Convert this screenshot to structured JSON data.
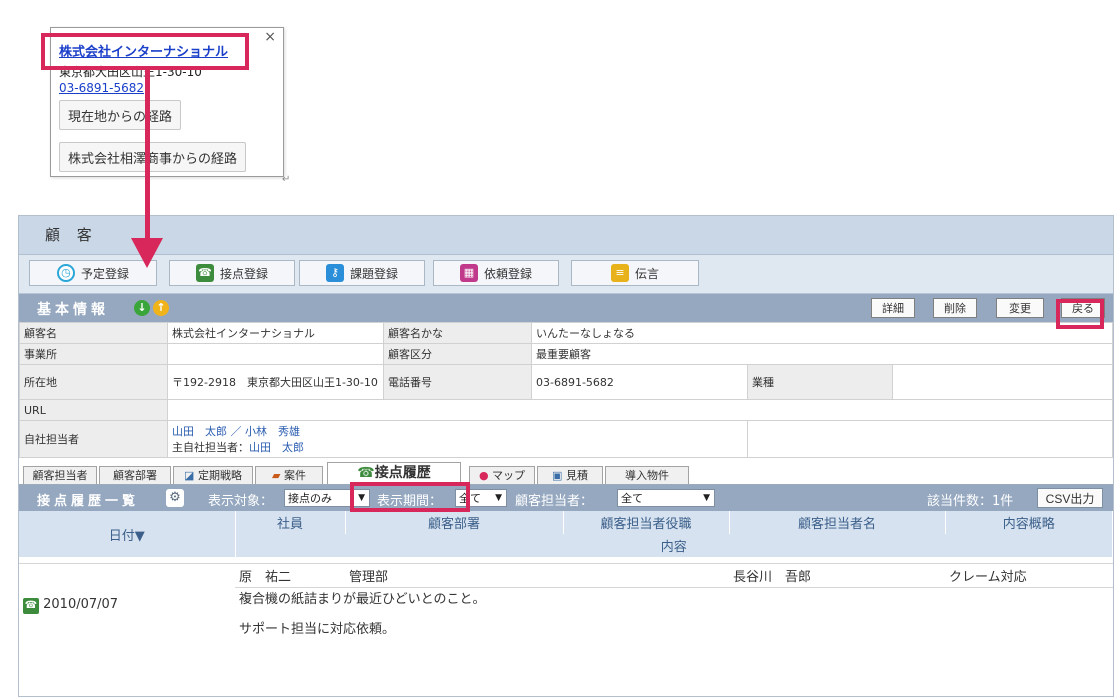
{
  "popup": {
    "close": "×",
    "company": "株式会社インターナショナル",
    "address": "東京都大田区山王1-30-10",
    "phone": "03-6891-5682",
    "route_current": "現在地からの経路",
    "route_office": "株式会社相澤商事からの経路"
  },
  "header": {
    "title": "顧 客"
  },
  "actions": [
    {
      "label": "予定登録",
      "icon": "clock-icon",
      "color": "#2aa7d8"
    },
    {
      "label": "接点登録",
      "icon": "contact-icon",
      "color": "#3d8c3d"
    },
    {
      "label": "課題登録",
      "icon": "key-icon",
      "color": "#2a8fd8"
    },
    {
      "label": "依頼登録",
      "icon": "gift-icon",
      "color": "#c0398a"
    },
    {
      "label": "伝言",
      "icon": "message-icon",
      "color": "#e8b21d"
    }
  ],
  "basic": {
    "title": "基本情報",
    "buttons": {
      "detail": "詳細",
      "delete": "削除",
      "edit": "変更",
      "back": "戻る"
    },
    "labels": {
      "name": "顧客名",
      "kana": "顧客名かな",
      "office": "事業所",
      "category": "顧客区分",
      "address": "所在地",
      "phone": "電話番号",
      "industry": "業種",
      "url": "URL",
      "staff": "自社担当者"
    },
    "values": {
      "name": "株式会社インターナショナル",
      "kana": "いんたーなしょなる",
      "office": "",
      "category": "最重要顧客",
      "address": "〒192-2918　東京都大田区山王1-30-10",
      "phone": "03-6891-5682",
      "industry": "",
      "url": "",
      "staff_line1": "山田　太郎 ／ 小林　秀雄",
      "staff_line2_label": "主自社担当者：",
      "staff_line2_name": "山田　太郎"
    }
  },
  "tabs": [
    {
      "label": "顧客担当者"
    },
    {
      "label": "顧客部署"
    },
    {
      "label": "定期戦略"
    },
    {
      "label": "案件"
    },
    {
      "label": "接点履歴"
    },
    {
      "label": "マップ"
    },
    {
      "label": "見積"
    },
    {
      "label": "導入物件"
    }
  ],
  "list": {
    "title": "接点履歴一覧",
    "target_label": "表示対象：",
    "target_value": "接点のみ",
    "period_label": "表示期間：",
    "period_value": "全て",
    "contact_label": "顧客担当者：",
    "contact_value": "全て",
    "count": "該当件数：1件",
    "csv": "CSV出力",
    "columns": {
      "date": "日付▼",
      "staff": "社員",
      "dept": "顧客部署",
      "role": "顧客担当者役職",
      "person": "顧客担当者名",
      "summary": "内容概略",
      "content": "内容"
    },
    "rows": [
      {
        "date": "2010/07/07",
        "staff": "原　祐二",
        "dept": "管理部",
        "role": "",
        "person": "長谷川　吾郎",
        "summary": "クレーム対応",
        "content1": "複合機の紙詰まりが最近ひどいとのこと。",
        "content2": "サポート担当に対応依頼。"
      }
    ]
  }
}
